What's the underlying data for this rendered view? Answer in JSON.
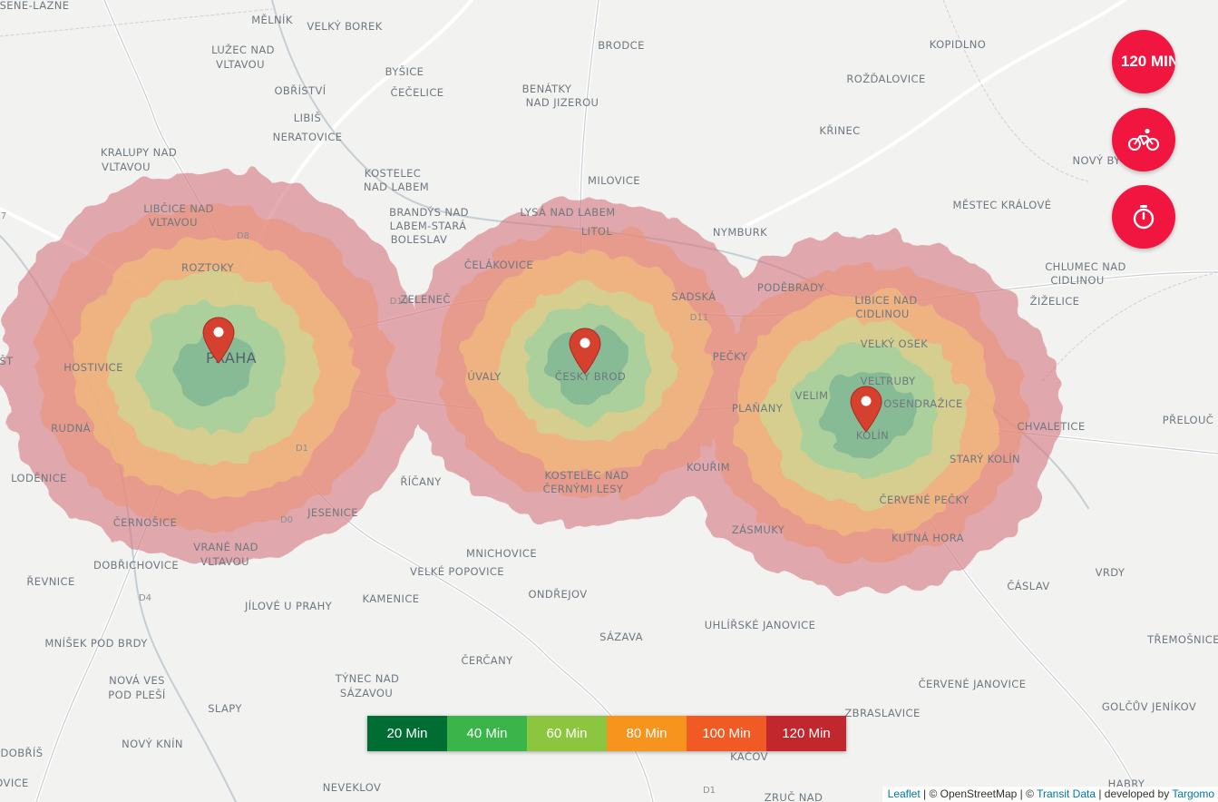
{
  "map": {
    "places": [
      {
        "name": "SENE-LAZNE"
      },
      {
        "name": "MĚLNÍK"
      },
      {
        "name": "VELKÝ BOREK"
      },
      {
        "name": "LUŽEC NAD"
      },
      {
        "name": "VLTAVOU"
      },
      {
        "name": "OBŘÍSTVÍ"
      },
      {
        "name": "BYŠICE"
      },
      {
        "name": "ČEČELICE"
      },
      {
        "name": "BRODCE"
      },
      {
        "name": "KOPIDLNO"
      },
      {
        "name": "ROŽĎALOVICE"
      },
      {
        "name": "BENÁTKY"
      },
      {
        "name": "NAD JIZEROU"
      },
      {
        "name": "LIBIŠ"
      },
      {
        "name": "NERATOVICE"
      },
      {
        "name": "KRALUPY NAD"
      },
      {
        "name": "VLTAVOU"
      },
      {
        "name": "KOSTELEC"
      },
      {
        "name": "NAD LABEM"
      },
      {
        "name": "KŘINEC"
      },
      {
        "name": "NOVÝ BY"
      },
      {
        "name": "MILOVICE"
      },
      {
        "name": "LIBČICE NAD"
      },
      {
        "name": "VLTAVOU"
      },
      {
        "name": "BRANDÝS NAD"
      },
      {
        "name": "LABEM-STARÁ"
      },
      {
        "name": "BOLESLAV"
      },
      {
        "name": "LYSÁ NAD LABEM"
      },
      {
        "name": "MĚSTEC KRÁLOVÉ"
      },
      {
        "name": "LITOL"
      },
      {
        "name": "NYMBURK"
      },
      {
        "name": "ČELÁKOVICE"
      },
      {
        "name": "ROZTOKY"
      },
      {
        "name": "CHLUMEC NAD"
      },
      {
        "name": "CIDLINOU"
      },
      {
        "name": "PODĚBRADY"
      },
      {
        "name": "ŽIŽELICE"
      },
      {
        "name": "ZELENEČ"
      },
      {
        "name": "SADSKÁ"
      },
      {
        "name": "LIBICE NAD"
      },
      {
        "name": "CIDLINOU"
      },
      {
        "name": "PRAHA"
      },
      {
        "name": "VELKÝ OSEK"
      },
      {
        "name": "HOSTIVICE"
      },
      {
        "name": "ÚVALY"
      },
      {
        "name": "ČESKÝ BROD"
      },
      {
        "name": "PEČKY"
      },
      {
        "name": "VELTRUBY"
      },
      {
        "name": "VELIM"
      },
      {
        "name": "ŠT"
      },
      {
        "name": "PLAŇANY"
      },
      {
        "name": "OSENDRAŽICE"
      },
      {
        "name": "RUDNÁ"
      },
      {
        "name": "KOLÍN"
      },
      {
        "name": "CHVALETICE"
      },
      {
        "name": "PŘELOUČ"
      },
      {
        "name": "STARÝ KOLÍN"
      },
      {
        "name": "LODĚNICE"
      },
      {
        "name": "ŘÍČANY"
      },
      {
        "name": "KOUŘIM"
      },
      {
        "name": "KOSTELEC NAD"
      },
      {
        "name": "ČERNÝMI LESY"
      },
      {
        "name": "ČERVENÉ PEČKY"
      },
      {
        "name": "JESENICE"
      },
      {
        "name": "ČERNOŠICE"
      },
      {
        "name": "ZÁSMUKY"
      },
      {
        "name": "KUTNÁ HORA"
      },
      {
        "name": "VRANÉ NAD"
      },
      {
        "name": "VLTAVOU"
      },
      {
        "name": "MNICHOVICE"
      },
      {
        "name": "DOBŘICHOVICE"
      },
      {
        "name": "VELKÉ POPOVICE"
      },
      {
        "name": "VRDY"
      },
      {
        "name": "ŘEVNICE"
      },
      {
        "name": "ČÁSLAV"
      },
      {
        "name": "ONDŘEJOV"
      },
      {
        "name": "JÍLOVÉ U PRAHY"
      },
      {
        "name": "KAMENICE"
      },
      {
        "name": "UHLÍŘSKÉ JANOVICE"
      },
      {
        "name": "SÁZAVA"
      },
      {
        "name": "MNÍŠEK POD BRDY"
      },
      {
        "name": "TŘEMOŠNICE"
      },
      {
        "name": "ČERČANY"
      },
      {
        "name": "NOVÁ VES"
      },
      {
        "name": "POD PLEŠÍ"
      },
      {
        "name": "TÝNEC NAD"
      },
      {
        "name": "SÁZAVOU"
      },
      {
        "name": "ČERVENÉ JANOVICE"
      },
      {
        "name": "SLAPY"
      },
      {
        "name": "ZBRASLAVICE"
      },
      {
        "name": "GOLČŮV JENÍKOV"
      },
      {
        "name": "DOBŘÍŠ"
      },
      {
        "name": "NOVÝ KNÍN"
      },
      {
        "name": "KAČOV"
      },
      {
        "name": "OVICE"
      },
      {
        "name": "NEVEKLOV"
      },
      {
        "name": "HABRY"
      },
      {
        "name": "ZRUČ NAD"
      }
    ],
    "road_labels": [
      "D8",
      "D10",
      "D11",
      "D1",
      "D0",
      "D4",
      "D1",
      "7"
    ],
    "markers": [
      {
        "name": "Praha",
        "color": "#d6402f"
      },
      {
        "name": "Český Brod",
        "color": "#d6402f"
      },
      {
        "name": "Kolín",
        "color": "#d6402f"
      }
    ]
  },
  "isochrones": {
    "bands": [
      {
        "minutes": 120,
        "color": "#d67a83",
        "opacity": 0.62
      },
      {
        "minutes": 100,
        "color": "#ea9379",
        "opacity": 0.6
      },
      {
        "minutes": 80,
        "color": "#f3c27a",
        "opacity": 0.62
      },
      {
        "minutes": 60,
        "color": "#c8df95",
        "opacity": 0.62
      },
      {
        "minutes": 40,
        "color": "#8ed0a5",
        "opacity": 0.6
      },
      {
        "minutes": 20,
        "color": "#6aaa8f",
        "opacity": 0.55
      }
    ]
  },
  "controls": {
    "time_button_label": "120 MIN",
    "mode_icon": "bike-icon",
    "timer_icon": "stopwatch-icon",
    "accent_color": "#f0163f"
  },
  "legend": {
    "items": [
      {
        "label": "20 Min",
        "color": "#006d33"
      },
      {
        "label": "40 Min",
        "color": "#39b54a"
      },
      {
        "label": "60 Min",
        "color": "#8cc63f"
      },
      {
        "label": "80 Min",
        "color": "#f7941d"
      },
      {
        "label": "100 Min",
        "color": "#f15a24"
      },
      {
        "label": "120 Min",
        "color": "#c1272d"
      }
    ]
  },
  "attribution": {
    "leaflet": "Leaflet",
    "sep1": " | © OpenStreetMap | © ",
    "transit": "Transit Data",
    "sep2": " | developed by ",
    "targomo": "Targomo"
  }
}
